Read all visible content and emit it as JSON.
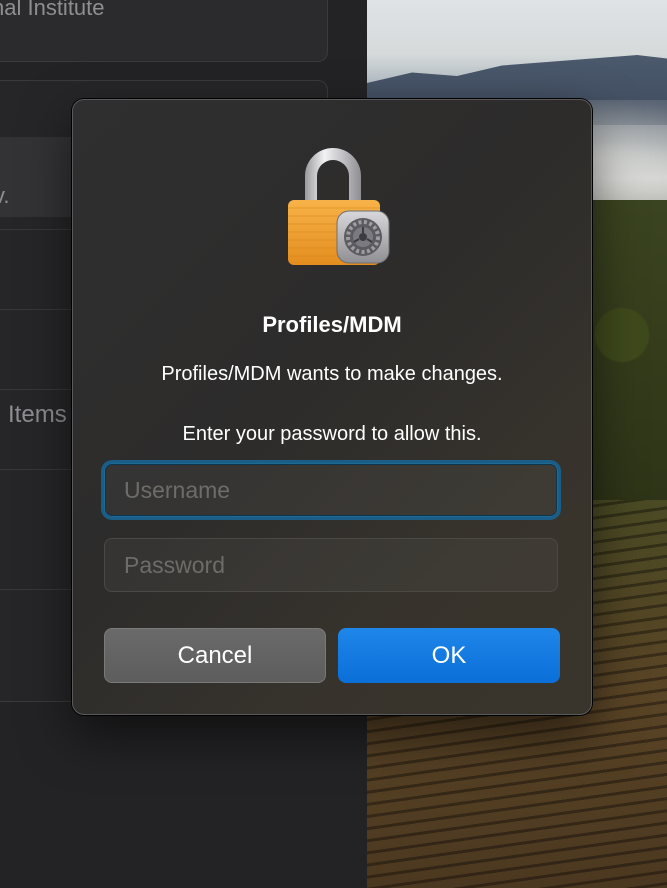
{
  "background_window": {
    "partial_text_top": "nal Institute",
    "partial_text_row": "v.",
    "partial_text_items": "n Items"
  },
  "dialog": {
    "icon": "lock-with-gear-icon",
    "title": "Profiles/MDM",
    "message": "Profiles/MDM wants to make changes.",
    "prompt": "Enter your password to allow this.",
    "username": {
      "value": "",
      "placeholder": "Username"
    },
    "password": {
      "value": "",
      "placeholder": "Password"
    },
    "cancel_label": "Cancel",
    "ok_label": "OK"
  },
  "colors": {
    "accent": "#0a6fd8",
    "focus_ring": "#1a5d86",
    "lock_body": "#f2a33b",
    "lock_shackle": "#c9c9cc"
  }
}
